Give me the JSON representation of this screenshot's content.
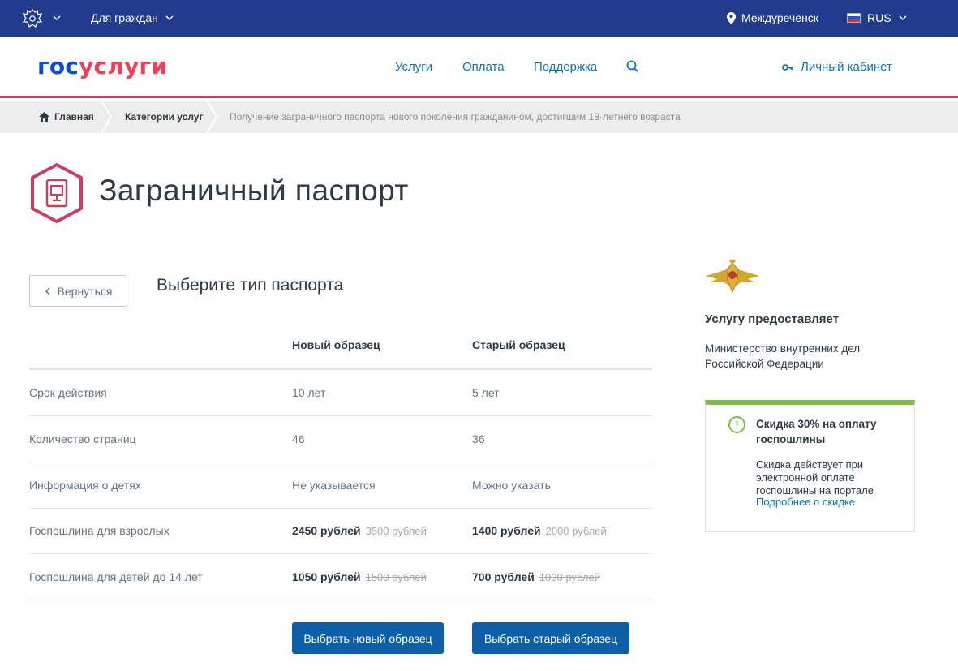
{
  "topbar": {
    "for_citizens": "Для граждан",
    "location": "Междуреченск",
    "language": "RUS"
  },
  "header": {
    "logo_part1": "гос",
    "logo_part2": "услуги",
    "nav": [
      "Услуги",
      "Оплата",
      "Поддержка"
    ],
    "cabinet": "Личный кабинет"
  },
  "breadcrumbs": {
    "home": "Главная",
    "categories": "Категории услуг",
    "current": "Получение заграничного паспорта нового поколения гражданином, достигшим 18-летнего возраста"
  },
  "page": {
    "title": "Заграничный паспорт",
    "back_label": "Вернуться",
    "section_title": "Выберите тип паспорта"
  },
  "table": {
    "col_new": "Новый образец",
    "col_old": "Старый образец",
    "rows": [
      {
        "label": "Срок действия",
        "new": "10 лет",
        "old": "5 лет"
      },
      {
        "label": "Количество страниц",
        "new": "46",
        "old": "36"
      },
      {
        "label": "Информация о детях",
        "new": "Не указывается",
        "old": "Можно указать"
      },
      {
        "label": "Госпошлина для взрослых",
        "new": "2450 рублей",
        "new_strike": "3500 рублей",
        "old": "1400 рублей",
        "old_strike": "2000 рублей"
      },
      {
        "label": "Госпошлина для детей до 14 лет",
        "new": "1050 рублей",
        "new_strike": "1500 рублей",
        "old": "700 рублей",
        "old_strike": "1000 рублей"
      }
    ],
    "btn_new": "Выбрать новый образец",
    "btn_old": "Выбрать старый образец"
  },
  "sidebar": {
    "provider_title": "Услугу предоставляет",
    "provider_name": "Министерство внутренних дел Российской Федерации",
    "promo_title": "Скидка 30% на оплату госпошлины",
    "promo_text": "Скидка действует при электронной оплате госпошлины на портале",
    "promo_link": "Подробнее о скидке"
  },
  "colors": {
    "topbar": "#233b8c",
    "accent_red": "#c8405e",
    "link": "#0d71b7",
    "button": "#0d5fa8",
    "promo_green": "#7ac143"
  },
  "icons": [
    "russia-emblem-icon",
    "chevron-down-icon",
    "location-pin-icon",
    "russia-flag-icon",
    "search-icon",
    "key-icon",
    "home-icon",
    "passport-icon",
    "chevron-left-icon",
    "mvd-emblem-icon",
    "exclamation-icon"
  ]
}
